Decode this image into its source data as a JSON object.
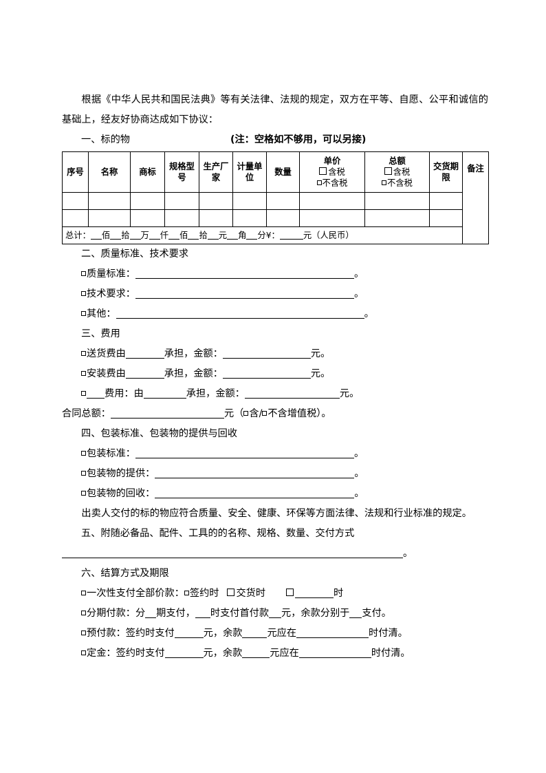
{
  "document": {
    "intro": "根据《中华人民共和国民法典》等有关法律、法规的规定，双方在平等、自愿、公平和诚信的基础上，经友好协商达成如下协议：",
    "sections": {
      "s1": {
        "heading": "一、标的物",
        "note": "(注：空格如不够用，可以另接)",
        "table": {
          "headers": [
            "序号",
            "名称",
            "商标",
            "规格型号",
            "生产厂家",
            "计量单位",
            "数量",
            "单价",
            "总额",
            "交货期限",
            "备注"
          ],
          "unit_price_options": [
            "含税",
            "不含税"
          ],
          "total_price_options": [
            "含税",
            "不含税"
          ],
          "empty_rows": 2,
          "total_row": {
            "label": "总计：",
            "units": [
              "佰",
              "拾",
              "万",
              "仟",
              "佰",
              "拾",
              "元",
              "角",
              "分"
            ],
            "currency_label": "¥：",
            "currency_suffix": "元（人民币）"
          }
        }
      },
      "s2": {
        "heading": "二、质量标准、技术要求",
        "items": [
          {
            "label": "质量标准：",
            "end": "。"
          },
          {
            "label": "技术要求：",
            "end": "。"
          },
          {
            "label": "其他：",
            "end": "。"
          }
        ]
      },
      "s3": {
        "heading": "三、费用",
        "delivery": {
          "label": "送货费由",
          "mid": "承担，金额：",
          "unit": "元。"
        },
        "install": {
          "label": "安装费由",
          "mid": "承担，金额：",
          "unit": "元。"
        },
        "other": {
          "label": "费用：由",
          "mid": "承担，金额：",
          "unit": "元。"
        },
        "contract_total": {
          "label": "合同总额：",
          "unit": "元",
          "tax_open": "（",
          "tax_incl": "含",
          "tax_sep": "/",
          "tax_excl": "不含增值税",
          "tax_close": "）。"
        }
      },
      "s4": {
        "heading": "四、包装标准、包装物的提供与回收",
        "items": [
          {
            "label": "包装标准：",
            "end": "。"
          },
          {
            "label": "包装物的提供：",
            "end": "。"
          },
          {
            "label": "包装物的回收：",
            "end": "。"
          }
        ],
        "paragraph": "出卖人交付的标的物应符合质量、安全、健康、环保等方面法律、法规和行业标准的规定。"
      },
      "s5": {
        "heading": "五、附随必备品、配件、工具的的名称、规格、数量、交付方式",
        "blank_end": "。"
      },
      "s6": {
        "heading": "六、结算方式及期限",
        "lump_sum": {
          "label": "一次性支付全部价款：",
          "opt1": "签约时",
          "opt2": "交货时",
          "opt3_suffix": "时"
        },
        "installment": {
          "p1": "分期付款：分",
          "p2": "期支付，",
          "p3": "时支付首付款",
          "p4": "元，余款分别于",
          "p5": "支付。"
        },
        "prepay": {
          "p1": "预付款：签约时支付",
          "p2": "元，余款",
          "p3": "元应在",
          "p4": "时付清。"
        },
        "deposit": {
          "p1": "定金：签约时支付",
          "p2": "元，余款",
          "p3": "元应在",
          "p4": "时付清。"
        }
      }
    }
  }
}
